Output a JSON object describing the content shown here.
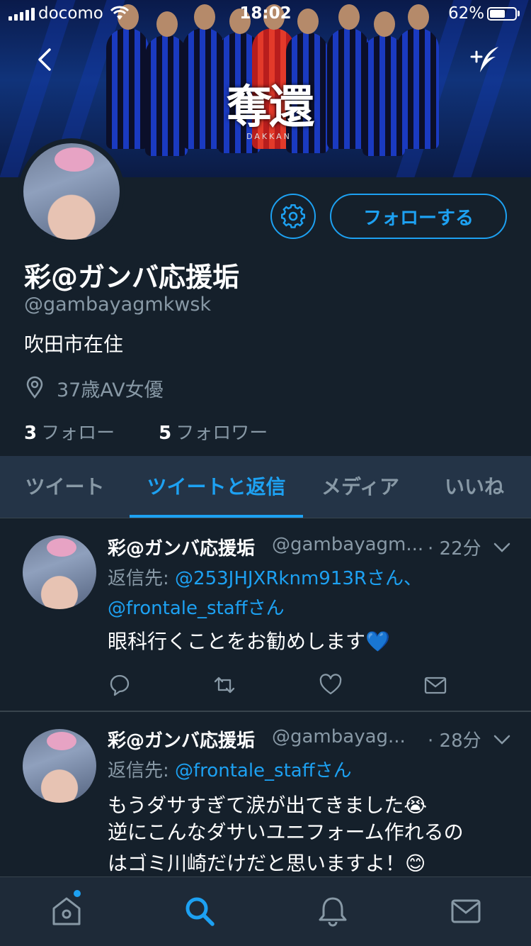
{
  "status_bar": {
    "carrier": "docomo",
    "time": "18:02",
    "battery": "62%",
    "battery_level": 0.62
  },
  "banner": {
    "title_kanji": "奪還",
    "title_kana": "DAKKAN"
  },
  "profile": {
    "name": "彩@ガンバ応援垢",
    "handle": "@gambayagmkwsk",
    "bio": "吹田市在住",
    "location": "37歳AV女優",
    "following_count": "3",
    "following_label": "フォロー",
    "followers_count": "5",
    "followers_label": "フォロワー",
    "follow_button": "フォローする"
  },
  "tabs": [
    {
      "label": "ツイート",
      "active": false
    },
    {
      "label": "ツイートと返信",
      "active": true
    },
    {
      "label": "メディア",
      "active": false
    },
    {
      "label": "いいね",
      "active": false
    }
  ],
  "tweets": [
    {
      "name": "彩@ガンバ応援垢",
      "handle": "@gambayagm...",
      "time": "· 22分",
      "reply_prefix": "返信先:",
      "reply_to_1": "@253JHJXRknm913Rさん、",
      "reply_to_2": "@frontale_staffさん",
      "lines": [
        "眼科行くことをお勧めします💙"
      ]
    },
    {
      "name": "彩@ガンバ応援垢",
      "handle": "@gambayag...",
      "time": "· 28分",
      "reply_prefix": "返信先:",
      "reply_to_1": "@frontale_staffさん",
      "lines": [
        "もうダサすぎて涙が出てきました😭",
        "逆にこんなダサいユニフォーム作れるの",
        "はゴミ川崎だけだと思いますよ！😊"
      ]
    }
  ],
  "colors": {
    "background": "#15202b",
    "accent": "#1da1f2",
    "secondary_text": "#8899a6",
    "tab_bar": "#243447"
  },
  "icons": {
    "back": "chevron-left-icon",
    "compose": "compose-tweet-icon",
    "settings": "gear-icon",
    "location": "location-pin-icon",
    "reply": "reply-icon",
    "retweet": "retweet-icon",
    "like": "heart-icon",
    "dm": "mail-icon",
    "nav": [
      "home-icon",
      "search-icon",
      "bell-icon",
      "mail-icon"
    ]
  }
}
